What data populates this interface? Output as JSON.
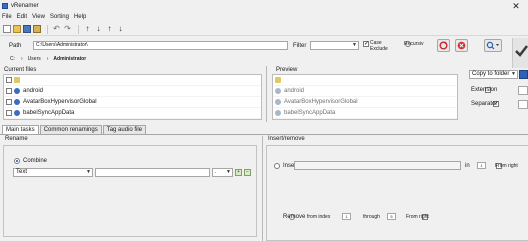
{
  "window": {
    "title": "vRenamer",
    "close": "✕"
  },
  "menu": [
    "File",
    "Edit",
    "View",
    "Sorting",
    "Help"
  ],
  "toolbar": {
    "arrows": [
      "↶",
      "↷",
      "↑",
      "↓",
      "↑",
      "↓"
    ]
  },
  "pathbar": {
    "path_label": "Path",
    "path_value": "C:\\Users\\Administrator\\",
    "filter_label": "Filter",
    "filter_value": "",
    "case_label_1": "Case",
    "case_label_2": "Exclude",
    "recursive_label": "Recursiv"
  },
  "breadcrumb": [
    "C:",
    "Users",
    "Administrator"
  ],
  "current_files": {
    "header": "Current files",
    "items": [
      "",
      "android",
      "AvatarBoxHypervisorGlobal",
      "babelSyncAppData"
    ]
  },
  "preview": {
    "header": "Preview",
    "items": [
      "",
      "android",
      "AvatarBoxHypervisorGlobal",
      "babelSyncAppData"
    ]
  },
  "options": {
    "copy_label": "Copy to folder",
    "extension_label": "Extension",
    "separator_label": "Separator"
  },
  "tabs": [
    "Main tasks",
    "Common renamings",
    "Tag audio file"
  ],
  "rename": {
    "header": "Rename",
    "combine_label": "Combine",
    "type_value": "Text",
    "text_value": "",
    "sep_value": "."
  },
  "insert_remove": {
    "header": "Insert/remove",
    "insert_label": "Insert",
    "in_label": "in",
    "in_value": "1",
    "from_right_label": "From right",
    "remove_label": "Remove",
    "from_index_label": "from index",
    "from_index_value": "1",
    "through_label": "through",
    "through_value": "5",
    "from_right_label_2": "From right"
  }
}
